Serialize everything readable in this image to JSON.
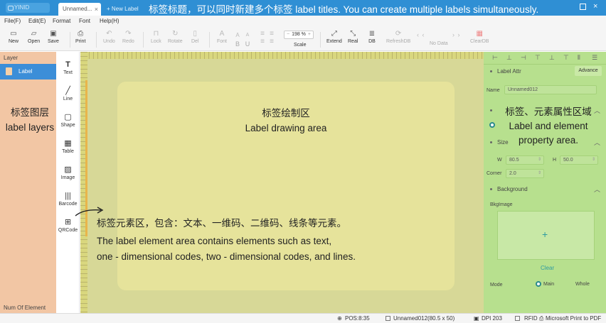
{
  "app": {
    "logo": "YINID",
    "active_tab": "Unnamed...",
    "new_tab": "+ New Label"
  },
  "annotations": {
    "title_bar": "标签标题，可以同时新建多个标签  label titles. You can create multiple labels simultaneously.",
    "layers_cn": "标签图层",
    "layers_en": "label layers",
    "canvas_cn": "标签绘制区",
    "canvas_en": "Label drawing area",
    "properties_cn": "标签、元素属性区域",
    "properties_en_1": "Label and element",
    "properties_en_2": "property area.",
    "elements_cn": "标签元素区，包含：文本、一维码、二维码、线条等元素。",
    "elements_en_1": "The label element area contains elements such as text,",
    "elements_en_2": "one - dimensional codes, two - dimensional codes, and lines."
  },
  "menu": [
    "File(F)",
    "Edit(E)",
    "Format",
    "Font",
    "Help(H)"
  ],
  "toolbar": {
    "new": "New",
    "open": "Open",
    "save": "Save",
    "print": "Print",
    "undo": "Undo",
    "redo": "Redo",
    "lock": "Lock",
    "rotate": "Rotate",
    "del": "Del",
    "font": "Font",
    "bold": "B",
    "underline": "U",
    "scale_value": "198 %",
    "scale_label": "Scale",
    "extend": "Extend",
    "real": "Real",
    "db": "DB",
    "refreshdb": "RefreshDB",
    "nodata": "No Data",
    "cleardb": "ClearDB"
  },
  "layers": {
    "header": "Layer",
    "items": [
      {
        "label": "Label"
      }
    ],
    "footer": "Num Of Element"
  },
  "tools": [
    "Text",
    "Line",
    "Shape",
    "Table",
    "Image",
    "Barcode",
    "QRCode"
  ],
  "properties": {
    "label_attr": "Label Attr",
    "advance": "Advance",
    "name_label": "Name",
    "name_value": "Unnamed012",
    "size": "Size",
    "w_label": "W",
    "w_value": "80.5",
    "h_label": "H",
    "h_value": "50.0",
    "corner_label": "Corner",
    "corner_value": "2.0",
    "background": "Background",
    "bkg_image": "BkgImage",
    "clear": "Clear",
    "mode_label": "Mode",
    "mode_main": "Main",
    "mode_whole": "Whole"
  },
  "status": {
    "pos": "POS:8:35",
    "label": "Unnamed012(80.5 x 50)",
    "dpi": "DPI 203",
    "rfid": "RFID",
    "printer": "Microsoft Print to PDF"
  },
  "colors": {
    "titlebar": "#2f8fd4",
    "layer_panel": "#f2c6a4",
    "canvas": "#d7d897",
    "label": "#e6e39b",
    "property_panel": "#b7e08e",
    "accent": "#2e9ba0"
  }
}
